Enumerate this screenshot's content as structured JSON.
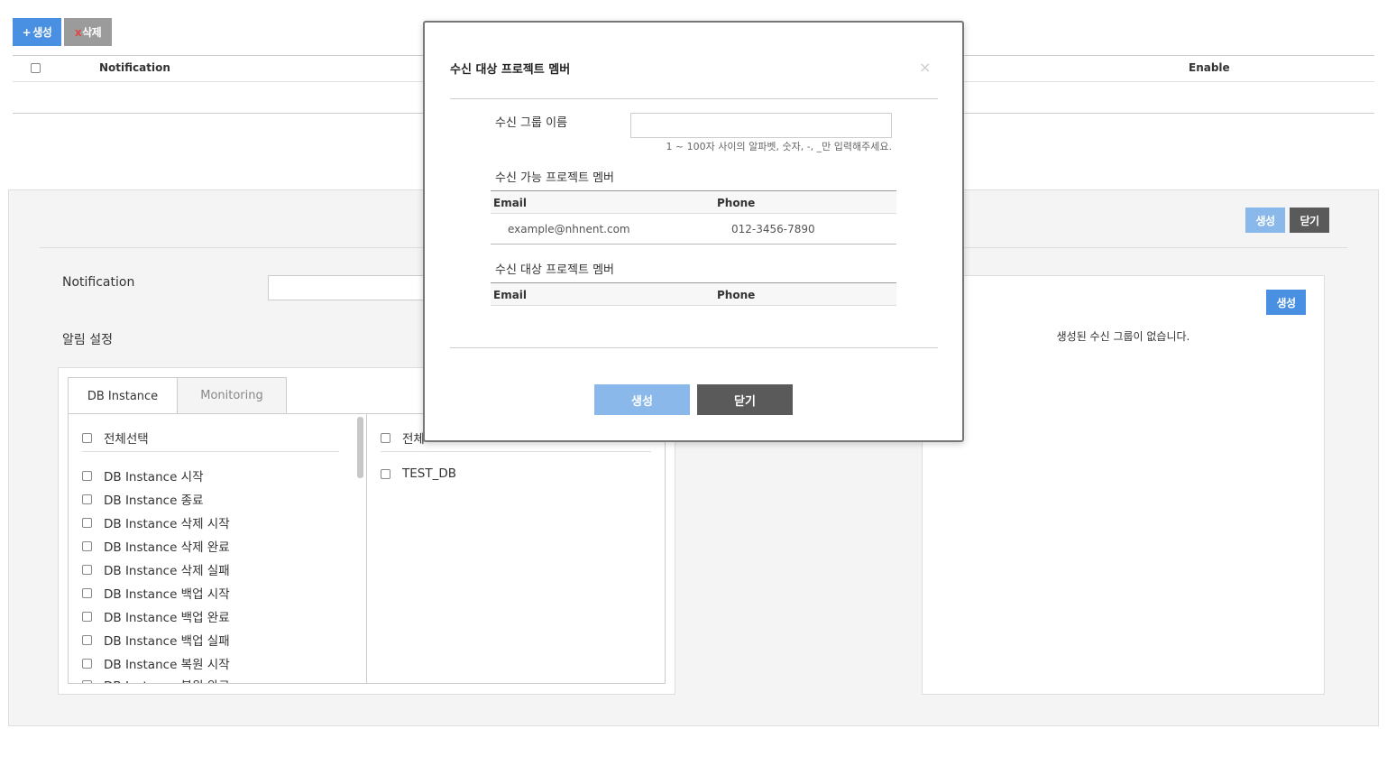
{
  "toolbar": {
    "create_label": "생성",
    "create_prefix": "+",
    "delete_label": "삭제",
    "delete_prefix": "x"
  },
  "list_table": {
    "columns": [
      "Notification",
      "Enable"
    ]
  },
  "panel": {
    "create_label": "생성",
    "close_label": "닫기",
    "notification_label": "Notification",
    "notification_value": "",
    "alarm_settings_label": "알림 설정",
    "tabs": [
      {
        "label": "DB Instance",
        "active": true
      },
      {
        "label": "Monitoring",
        "active": false
      }
    ],
    "event_select_all": "전체선택",
    "events": [
      "DB Instance 시작",
      "DB Instance 종료",
      "DB Instance 삭제 시작",
      "DB Instance 삭제 완료",
      "DB Instance 삭제 실패",
      "DB Instance 백업 시작",
      "DB Instance 백업 완료",
      "DB Instance 백업 실패",
      "DB Instance 복원 시작",
      "DB Instance 복원 완료"
    ],
    "instance_select_all": "전체",
    "instances": [
      "TEST_DB"
    ],
    "group_create_label": "생성",
    "no_group_text": "생성된 수신 그룹이 없습니다."
  },
  "modal": {
    "title": "수신 대상 프로젝트 멤버",
    "close_glyph": "×",
    "group_name_label": "수신 그룹 이름",
    "group_name_value": "",
    "group_name_hint": "1 ~ 100자 사이의 알파벳, 숫자, -, _만 입력해주세요.",
    "available_label": "수신 가능 프로젝트 멤버",
    "target_label": "수신 대상 프로젝트 멤버",
    "columns": {
      "email": "Email",
      "phone": "Phone"
    },
    "available_members": [
      {
        "email": "example@nhnent.com",
        "phone": "012-3456-7890"
      }
    ],
    "create_label": "생성",
    "close_label": "닫기"
  },
  "colors": {
    "primary": "#4a90e2",
    "primary_disabled": "#8ab8ea",
    "dark_button": "#5a5a5a",
    "gray_button": "#9b9b9b"
  }
}
